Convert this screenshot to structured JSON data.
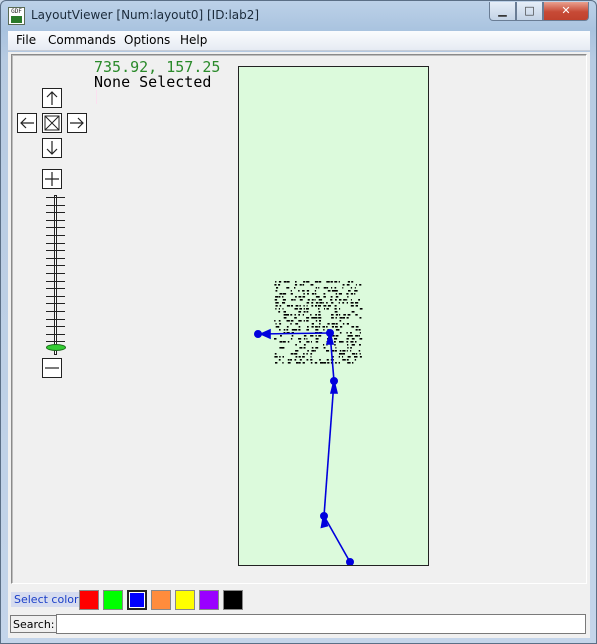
{
  "window": {
    "title": "LayoutViewer [Num:layout0] [ID:lab2]",
    "app_icon_text": "GDF",
    "controls": {
      "minimize": "▁",
      "maximize": "□",
      "close": "✕"
    }
  },
  "menu": {
    "items": [
      {
        "label": "File"
      },
      {
        "label": "Commands"
      },
      {
        "label": "Options"
      },
      {
        "label": "Help"
      }
    ]
  },
  "viewer": {
    "cursor_coords": "735.92, 157.25",
    "selection_text": "None Selected",
    "canvas_color": "#dcfadc",
    "path_color": "#0000dd",
    "zoom_level_fraction": 0.0
  },
  "navigation": {
    "buttons": [
      "pan-up",
      "pan-left",
      "fit",
      "pan-right",
      "pan-down",
      "zoom-in",
      "zoom-out"
    ]
  },
  "status": {
    "select_color_label": "Select color:",
    "colors": [
      {
        "name": "red",
        "hex": "#ff0000"
      },
      {
        "name": "green",
        "hex": "#00ff00"
      },
      {
        "name": "blue",
        "hex": "#0000ff",
        "selected": true
      },
      {
        "name": "orange",
        "hex": "#ff8c3c"
      },
      {
        "name": "yellow",
        "hex": "#ffff00"
      },
      {
        "name": "purple",
        "hex": "#9a00ff"
      },
      {
        "name": "black",
        "hex": "#000000"
      }
    ]
  },
  "search": {
    "label": "Search:",
    "value": "",
    "placeholder": ""
  }
}
